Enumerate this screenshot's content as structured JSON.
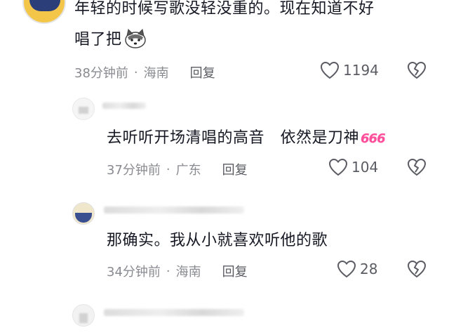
{
  "comments": [
    {
      "text_line1": "年轻的时候写歌没轻没重的。现在知道不好",
      "text_line2": "唱了把",
      "time": "38分钟前",
      "location": "海南",
      "reply_label": "回复",
      "likes": "1194"
    },
    {
      "text": "去听听开场清唱的高音　依然是刀神",
      "emoji_text": "666",
      "time": "37分钟前",
      "location": "广东",
      "reply_label": "回复",
      "likes": "104"
    },
    {
      "text": "那确实。我从小就喜欢听他的歌",
      "time": "34分钟前",
      "location": "海南",
      "reply_label": "回复",
      "likes": "28"
    }
  ],
  "separator": "·",
  "icons": {
    "like": "heart-outline-icon",
    "dislike": "broken-heart-icon",
    "emoji_dog": "husky-emoji-icon"
  },
  "colors": {
    "text": "#161823",
    "meta": "#8a8b91",
    "emoji_666": "#ff4f9a"
  }
}
